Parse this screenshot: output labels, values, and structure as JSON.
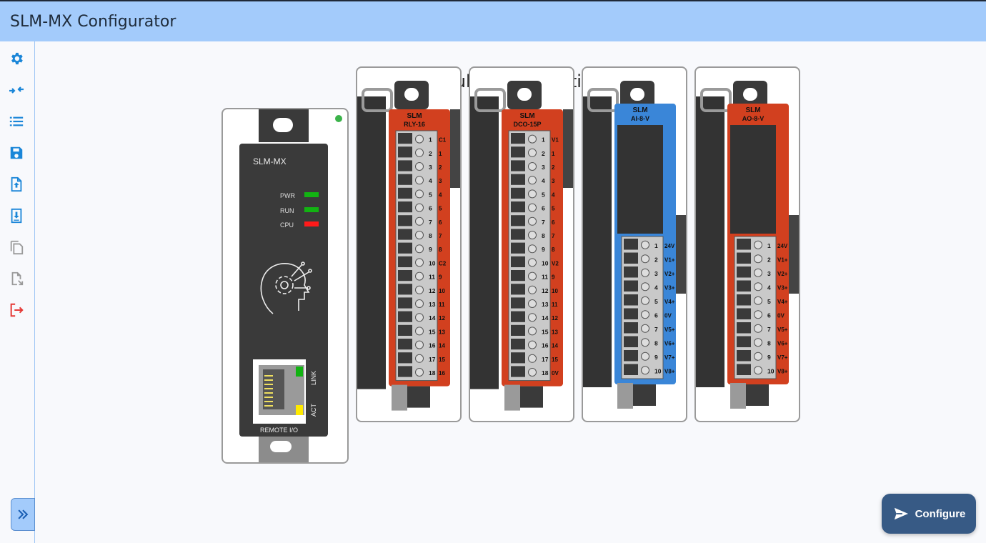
{
  "app": {
    "title": "SLM-MX Configurator"
  },
  "sidebar": {
    "icons": [
      {
        "name": "gear-icon"
      },
      {
        "name": "compress-arrows-icon"
      },
      {
        "name": "list-icon"
      },
      {
        "name": "save-icon"
      },
      {
        "name": "file-upload-icon"
      },
      {
        "name": "file-download-icon"
      },
      {
        "name": "copy-icon"
      },
      {
        "name": "file-report-icon"
      },
      {
        "name": "logout-icon"
      }
    ],
    "accent": "#1a86d8",
    "logout_color": "#e53935"
  },
  "main": {
    "title": "Module Configuration"
  },
  "cpu_module": {
    "name": "SLM-MX",
    "leds": [
      {
        "label": "PWR",
        "color": "#12b312"
      },
      {
        "label": "RUN",
        "color": "#12b312"
      },
      {
        "label": "CPU",
        "color": "#ff1a1a"
      }
    ],
    "port_label": "REMOTE I/O",
    "link_label": "LINK",
    "act_label": "ACT",
    "status_dot": "#3bb34a"
  },
  "modules": [
    {
      "brand": "SLM",
      "model": "RLY-16",
      "color": "#d2401f",
      "labels": [
        "C1",
        "1",
        "2",
        "3",
        "4",
        "5",
        "6",
        "7",
        "8",
        "C2",
        "9",
        "10",
        "11",
        "12",
        "13",
        "14",
        "15",
        "16"
      ]
    },
    {
      "brand": "SLM",
      "model": "DCO-15P",
      "color": "#d2401f",
      "labels": [
        "V1",
        "1",
        "2",
        "3",
        "4",
        "5",
        "6",
        "7",
        "8",
        "V2",
        "9",
        "10",
        "11",
        "12",
        "13",
        "14",
        "15",
        "0V"
      ]
    },
    {
      "brand": "SLM",
      "model": "AI-8-V",
      "color": "#3a86d8",
      "labels": [
        "24V",
        "V1+",
        "V2+",
        "V3+",
        "V4+",
        "0V",
        "V5+",
        "V6+",
        "V7+",
        "V8+"
      ]
    },
    {
      "brand": "SLM",
      "model": "AO-8-V",
      "color": "#d2401f",
      "labels": [
        "24V",
        "V1+",
        "V2+",
        "V3+",
        "V4+",
        "0V",
        "V5+",
        "V6+",
        "V7+",
        "V8+"
      ]
    }
  ],
  "actions": {
    "configure_label": "Configure"
  }
}
